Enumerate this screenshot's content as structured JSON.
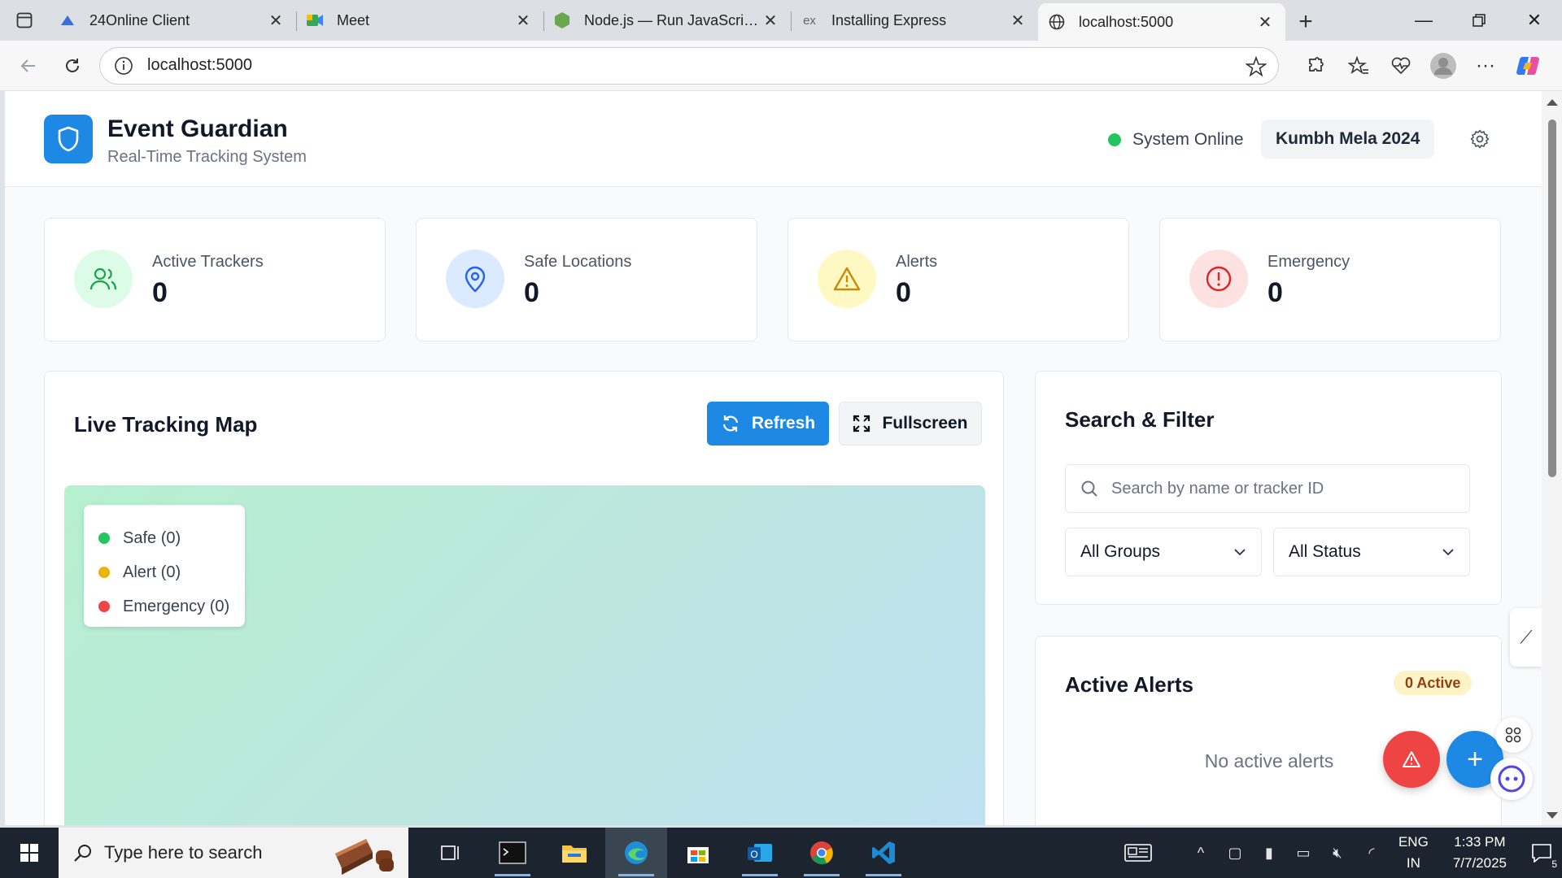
{
  "browser": {
    "tabs": [
      {
        "title": "24Online Client",
        "icon": "24online-icon",
        "active": false
      },
      {
        "title": "Meet",
        "icon": "google-meet-icon",
        "active": false
      },
      {
        "title": "Node.js — Run JavaScript Everywhere",
        "icon": "nodejs-icon",
        "active": false
      },
      {
        "title": "Installing Express",
        "icon": "express-icon",
        "active": false
      },
      {
        "title": "localhost:5000",
        "icon": "globe-icon",
        "active": true
      }
    ],
    "address": "localhost:5000"
  },
  "app": {
    "title": "Event Guardian",
    "subtitle": "Real-Time Tracking System",
    "status_text": "System Online",
    "event_name": "Kumbh Mela 2024",
    "colors": {
      "primary": "#1e88e5",
      "online": "#22c55e",
      "safe": "#22c55e",
      "alert": "#eab308",
      "emergency": "#ef4444"
    }
  },
  "stats": [
    {
      "label": "Active Trackers",
      "value": "0",
      "icon": "users-icon"
    },
    {
      "label": "Safe Locations",
      "value": "0",
      "icon": "map-pin-icon"
    },
    {
      "label": "Alerts",
      "value": "0",
      "icon": "warning-triangle-icon"
    },
    {
      "label": "Emergency",
      "value": "0",
      "icon": "alert-circle-icon"
    }
  ],
  "map": {
    "title": "Live Tracking Map",
    "refresh_label": "Refresh",
    "fullscreen_label": "Fullscreen",
    "legend": [
      {
        "label": "Safe (0)",
        "color": "#22c55e"
      },
      {
        "label": "Alert (0)",
        "color": "#eab308"
      },
      {
        "label": "Emergency (0)",
        "color": "#ef4444"
      }
    ]
  },
  "filter": {
    "title": "Search & Filter",
    "search_placeholder": "Search by name or tracker ID",
    "group_select": "All Groups",
    "status_select": "All Status"
  },
  "alerts": {
    "title": "Active Alerts",
    "badge": "0 Active",
    "empty_text": "No active alerts"
  },
  "taskbar": {
    "search_placeholder": "Type here to search",
    "lang_line1": "ENG",
    "lang_line2": "IN",
    "time": "1:33 PM",
    "date": "7/7/2025",
    "notification_count": "5"
  }
}
